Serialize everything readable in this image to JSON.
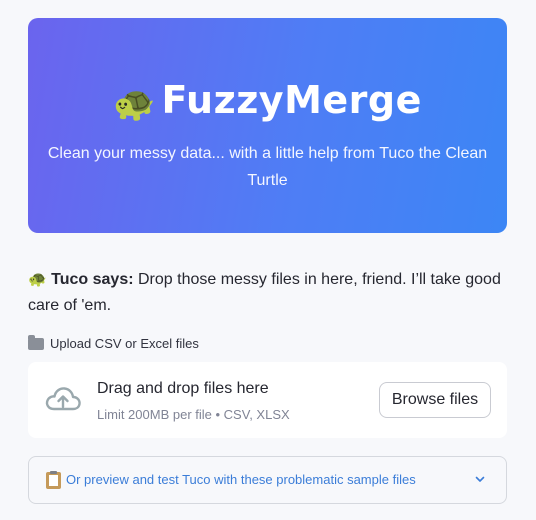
{
  "hero": {
    "icon": "turtle-emoji",
    "turtle_glyph": "🐢",
    "title": "FuzzyMerge",
    "subtitle": "Clean your messy data... with a little help from Tuco the Clean Turtle",
    "gradient_start": "#6b64ee",
    "gradient_end": "#3c86f5"
  },
  "tuco": {
    "icon": "turtle-emoji",
    "turtle_glyph": "🐢",
    "label": "Tuco says:",
    "message": " Drop those messy files in here, friend. I’ll take good care of 'em."
  },
  "upload": {
    "icon": "folder-icon",
    "label": "Upload CSV or Excel files",
    "dropzone": {
      "icon": "cloud-upload-icon",
      "main_text": "Drag and drop files here",
      "limit_text": "Limit 200MB per file • CSV, XLSX",
      "browse_label": "Browse files"
    }
  },
  "expander": {
    "icon": "clipboard-icon",
    "label": "Or preview and test Tuco with these problematic sample files",
    "chevron_icon": "chevron-down-icon",
    "link_color": "#3b7dd8"
  }
}
